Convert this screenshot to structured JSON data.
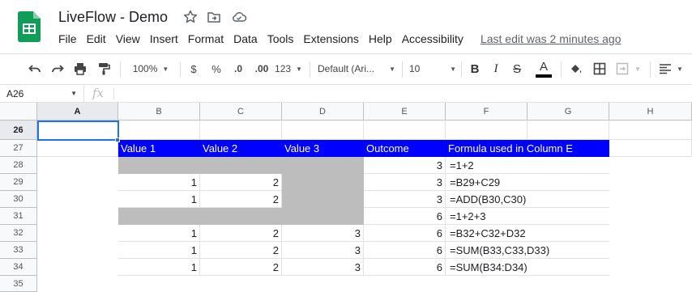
{
  "app": {
    "doc_title": "LiveFlow - Demo",
    "icons": [
      "star-icon",
      "move-to-folder-icon",
      "cloud-status-icon"
    ],
    "logo_color": "#0f9d58"
  },
  "menu": {
    "items": [
      "File",
      "Edit",
      "View",
      "Insert",
      "Format",
      "Data",
      "Tools",
      "Extensions",
      "Help",
      "Accessibility"
    ],
    "last_edit": "Last edit was 2 minutes ago"
  },
  "toolbar": {
    "zoom": "100%",
    "currency": "$",
    "percent": "%",
    "dec_decrease": ".0",
    "dec_increase": ".00",
    "more_formats": "123",
    "font_family": "Default (Ari...",
    "font_size": "10",
    "bold": "B",
    "italic": "I",
    "strike": "S",
    "text_color_letter": "A"
  },
  "formula_bar": {
    "name_box": "A26",
    "fx_label": "fx",
    "value": ""
  },
  "grid": {
    "columns": [
      "A",
      "B",
      "C",
      "D",
      "E",
      "F",
      "G",
      "H"
    ],
    "rows": [
      "26",
      "27",
      "28",
      "29",
      "30",
      "31",
      "32",
      "33",
      "34",
      "35"
    ],
    "selected_cell": "A26",
    "header_row": [
      "Value 1",
      "Value 2",
      "Value 3",
      "Outcome",
      "Formula used in Column E"
    ],
    "data_rows": [
      {
        "b": "",
        "c": "",
        "d": "",
        "e": "3",
        "f": "=1+2"
      },
      {
        "b": "1",
        "c": "2",
        "d": "",
        "e": "3",
        "f": "=B29+C29"
      },
      {
        "b": "1",
        "c": "2",
        "d": "",
        "e": "3",
        "f": "=ADD(B30,C30)"
      },
      {
        "b": "",
        "c": "",
        "d": "",
        "e": "6",
        "f": "=1+2+3"
      },
      {
        "b": "1",
        "c": "2",
        "d": "3",
        "e": "6",
        "f": "=B32+C32+D32"
      },
      {
        "b": "1",
        "c": "2",
        "d": "3",
        "e": "6",
        "f": "=SUM(B33,C33,D33)"
      },
      {
        "b": "1",
        "c": "2",
        "d": "3",
        "e": "6",
        "f": "=SUM(B34:D34)"
      }
    ],
    "colors": {
      "header_fill": "#0000ff",
      "header_text": "#ffffff",
      "grey_fill": "#bdbdbd",
      "selection": "#1a73e8"
    }
  }
}
